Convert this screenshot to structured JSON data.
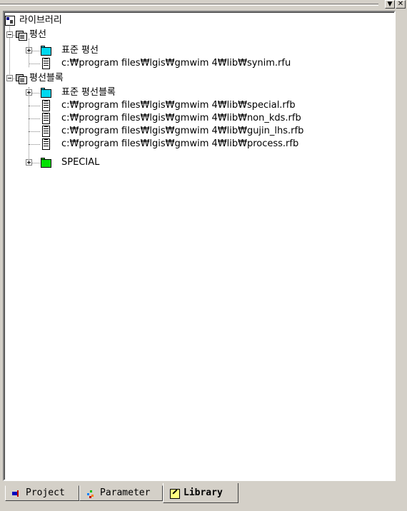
{
  "window": {
    "controls": {
      "dropdown_glyph": "▼",
      "close_glyph": "✕"
    }
  },
  "tree": {
    "root": {
      "label": "라이브러리",
      "icon": "library-icon"
    },
    "groups": [
      {
        "label": "평선",
        "icon": "database-icon",
        "expanded": true,
        "children": [
          {
            "type": "folder",
            "label": "표준 평선",
            "icon": "folder-icon",
            "color": "#00d8f0",
            "expanded": false
          },
          {
            "type": "file",
            "label": "c:₩program files₩lgis₩gmwim 4₩lib₩synim.rfu",
            "icon": "document-icon"
          }
        ]
      },
      {
        "label": "평선블록",
        "icon": "database-icon",
        "expanded": true,
        "children": [
          {
            "type": "folder",
            "label": "표준 평선블록",
            "icon": "folder-icon",
            "color": "#00d8f0",
            "expanded": false
          },
          {
            "type": "file",
            "label": "c:₩program files₩lgis₩gmwim 4₩lib₩special.rfb",
            "icon": "document-icon"
          },
          {
            "type": "file",
            "label": "c:₩program files₩lgis₩gmwim 4₩lib₩non_kds.rfb",
            "icon": "document-icon"
          },
          {
            "type": "file",
            "label": "c:₩program files₩lgis₩gmwim 4₩lib₩gujin_lhs.rfb",
            "icon": "document-icon"
          },
          {
            "type": "file",
            "label": "c:₩program files₩lgis₩gmwim 4₩lib₩process.rfb",
            "icon": "document-icon"
          },
          {
            "type": "folder",
            "label": "SPECIAL",
            "icon": "folder-icon",
            "color": "#00e000",
            "expanded": false
          }
        ]
      }
    ]
  },
  "tabs": [
    {
      "label": "Project",
      "icon": "project-icon",
      "active": false
    },
    {
      "label": "Parameter",
      "icon": "parameter-icon",
      "active": false
    },
    {
      "label": "Library",
      "icon": "library-tab-icon",
      "active": true
    }
  ]
}
